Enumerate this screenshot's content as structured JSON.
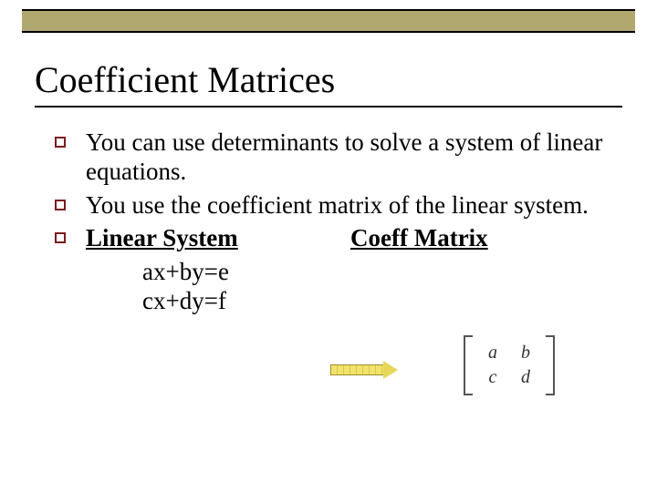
{
  "title": "Coefficient Matrices",
  "bullets": [
    "You can use determinants to solve a system of linear equations.",
    "You use the coefficient matrix of the linear system."
  ],
  "columns": {
    "left_heading": "Linear System",
    "right_heading": "Coeff Matrix"
  },
  "equations": {
    "line1": "ax+by=e",
    "line2": "cx+dy=f"
  },
  "matrix": {
    "r1c1": "a",
    "r1c2": "b",
    "r2c1": "c",
    "r2c2": "d"
  }
}
